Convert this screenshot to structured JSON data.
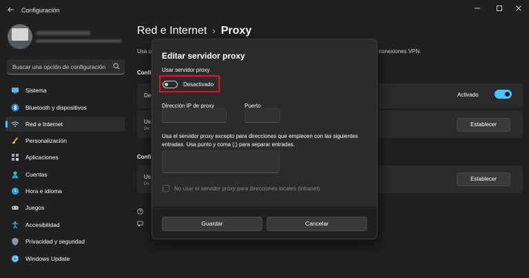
{
  "window": {
    "title": "Configuración"
  },
  "sidebar": {
    "search_placeholder": "Buscar una opción de configuración",
    "items": [
      {
        "label": "Sistema",
        "icon": "monitor-icon"
      },
      {
        "label": "Bluetooth y dispositivos",
        "icon": "bluetooth-icon"
      },
      {
        "label": "Red e Internet",
        "icon": "wifi-icon"
      },
      {
        "label": "Personalización",
        "icon": "brush-icon"
      },
      {
        "label": "Aplicaciones",
        "icon": "apps-icon"
      },
      {
        "label": "Cuentas",
        "icon": "person-icon"
      },
      {
        "label": "Hora e idioma",
        "icon": "globe-clock-icon"
      },
      {
        "label": "Juegos",
        "icon": "gamepad-icon"
      },
      {
        "label": "Accesibilidad",
        "icon": "accessibility-icon"
      },
      {
        "label": "Privacidad y seguridad",
        "icon": "shield-icon"
      },
      {
        "label": "Windows Update",
        "icon": "update-icon"
      }
    ],
    "active_index": 2
  },
  "main": {
    "breadcrumb_parent": "Red e Internet",
    "breadcrumb_sep": "›",
    "breadcrumb_current": "Proxy",
    "desc_left": "Usa u",
    "desc_right": "conexiones VPN.",
    "section1_header": "Confi",
    "section2_header": "Confi",
    "row1_title": "De",
    "row1_state": "Activado",
    "row2_title": "Us",
    "row2_sub": "De",
    "row3_title": "Us",
    "row3_sub": "De",
    "set_button_1": "Establecer",
    "set_button_2": "Establecer"
  },
  "dialog": {
    "title": "Editar servidor proxy",
    "use_proxy_label": "Usar servidor proxy",
    "toggle_state": "Desactivado",
    "ip_label": "Dirección IP de proxy",
    "port_label": "Puerto",
    "ip_value": "",
    "port_value": "",
    "exceptions_text": "Usa el servidor proxy excepto para direcciones que empiecen con las siguientes entradas. Usa punto y coma (;) para separar entradas.",
    "exceptions_value": "",
    "local_checkbox_label": "No usar el servidor proxy para direcciones locales (intranet)",
    "save_label": "Guardar",
    "cancel_label": "Cancelar"
  },
  "colors": {
    "accent": "#4cc2ff",
    "highlight": "#e81123",
    "background": "#202020",
    "card": "#2b2b2b"
  }
}
